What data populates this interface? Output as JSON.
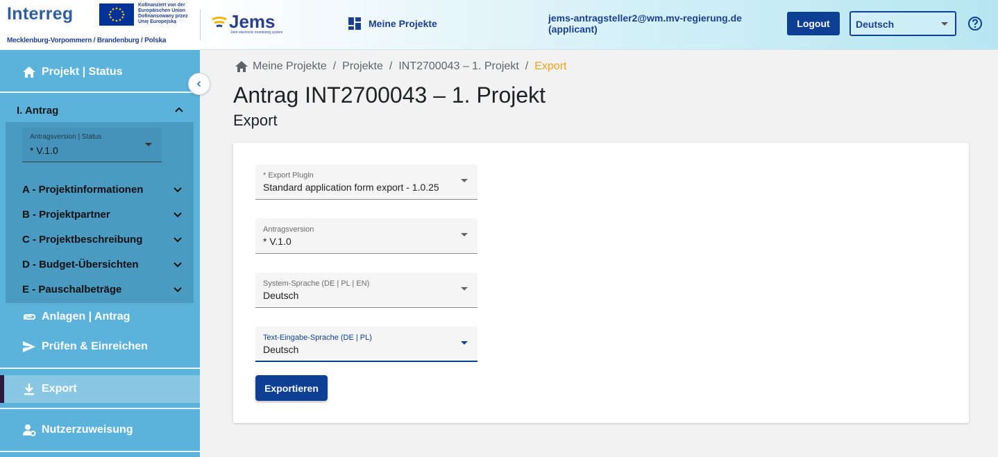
{
  "header": {
    "brand": {
      "interreg": "Interreg",
      "eu_text": [
        "Kofinanziert von der",
        "Europäischen Union",
        "Dofinansowany przez",
        "Unię Europejską"
      ],
      "region": "Mecklenburg-Vorpommern / Brandenburg / Polska",
      "jems": "Jems",
      "jems_sub": "Joint electronic monitoring system"
    },
    "nav_meine_projekte": "Meine Projekte",
    "user_email": "jems-antragsteller2@wm.mv-regierung.de",
    "user_role": "(applicant)",
    "logout_label": "Logout",
    "language_selected": "Deutsch",
    "help_icon": "help-circle-icon"
  },
  "sidebar": {
    "projekt_status": "Projekt | Status",
    "antrag_title": "I. Antrag",
    "version_label": "Antragsversion | Status",
    "version_value": "* V.1.0",
    "sections": [
      "A - Projektinformationen",
      "B - Projektpartner",
      "C - Projektbeschreibung",
      "D - Budget-Übersichten",
      "E - Pauschalbeträge"
    ],
    "anlagen": "Anlagen | Antrag",
    "pruefen": "Prüfen & Einreichen",
    "export": "Export",
    "nutzerzuweisung": "Nutzerzuweisung"
  },
  "breadcrumb": {
    "items": [
      "Meine Projekte",
      "Projekte",
      "INT2700043 – 1. Projekt"
    ],
    "current": "Export"
  },
  "page": {
    "title": "Antrag INT2700043 – 1. Projekt",
    "subtitle": "Export"
  },
  "form": {
    "fields": [
      {
        "label": "* Export Plugin",
        "value": "Standard application form export - 1.0.25"
      },
      {
        "label": "Antragsversion",
        "value": "* V.1.0"
      },
      {
        "label": "System-Sprache (DE | PL | EN)",
        "value": "Deutsch"
      },
      {
        "label": "Text-Eingabe-Sprache (DE | PL)",
        "value": "Deutsch"
      }
    ],
    "submit_label": "Exportieren"
  },
  "colors": {
    "primary": "#0d3f94",
    "sidebar": "#5bb2da",
    "breadcrumb_current": "#e8a317"
  }
}
